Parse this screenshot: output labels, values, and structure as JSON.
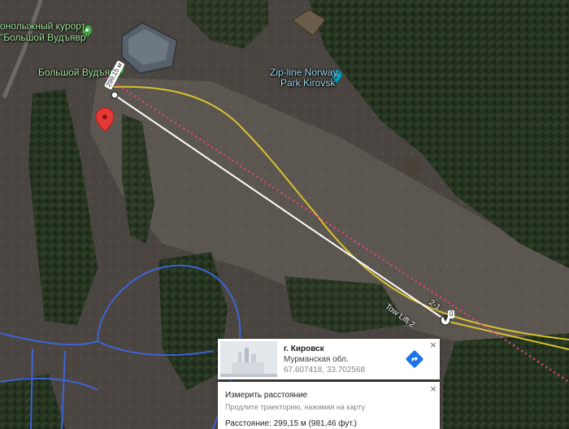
{
  "map": {
    "mode": "satellite",
    "poi": [
      {
        "label": "онолыжный курорт",
        "color": "#a9e7a2"
      },
      {
        "label": "\"Большой Вудъявр\"",
        "color": "#a9e7a2"
      },
      {
        "label": "Большой Вудъявр",
        "color": "#a9e7a2"
      },
      {
        "label": "Zip-line Norway",
        "color": "#9fd9ee"
      },
      {
        "label": "Park Kirovsk",
        "color": "#9fd9ee"
      }
    ],
    "lift_labels": [
      "Tow Lift 2",
      "2-1"
    ],
    "measure_line": {
      "start_label": "299,15 м",
      "end_label": "0",
      "color": "#ffffff"
    },
    "route_colors": {
      "path": "#d9c22e",
      "lift": "#e0457b",
      "roads": "#3f63d8",
      "marker": "#e53935"
    }
  },
  "place_card": {
    "title": "г. Кировск",
    "region": "Мурманская обл.",
    "coordinates": "67.607418, 33.702568",
    "close_label": "×",
    "directions_icon": "directions-arrow-icon"
  },
  "measure_card": {
    "title": "Измерить расстояние",
    "hint": "Продлите траекторию, нажимая на карту",
    "distance": "Расстояние: 299,15 м (981,46 фут.)"
  }
}
